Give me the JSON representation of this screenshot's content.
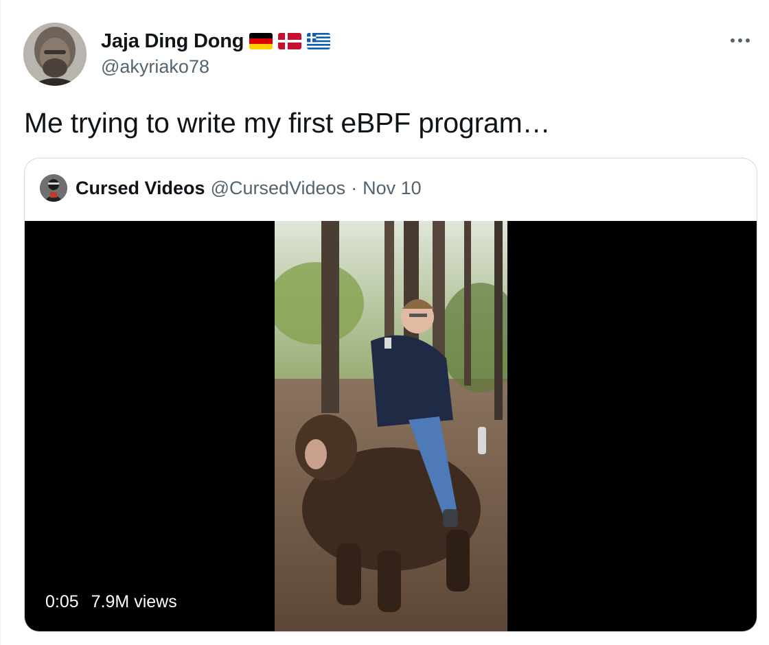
{
  "author": {
    "display_name": "Jaja Ding Dong",
    "handle": "@akyriako78",
    "avatar_icon": "profile-photo",
    "flags": [
      "germany-flag-icon",
      "denmark-flag-icon",
      "greece-flag-icon"
    ]
  },
  "more_icon": "more-horizontal-icon",
  "tweet_text": "Me trying to write my first eBPF program…",
  "quoted": {
    "display_name": "Cursed Videos",
    "handle": "@CursedVideos",
    "separator": "·",
    "date": "Nov 10",
    "video": {
      "timestamp": "0:05",
      "views": "7.9M views"
    }
  },
  "colors": {
    "text_primary": "#0f1419",
    "text_secondary": "#536471",
    "border": "#cfd9de"
  }
}
